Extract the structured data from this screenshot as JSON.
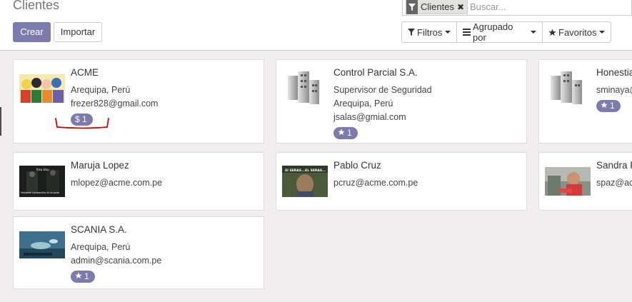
{
  "page": {
    "title": "Clientes"
  },
  "buttons": {
    "create": "Crear",
    "import": "Importar"
  },
  "search": {
    "facet_value": "Clientes",
    "facet_icon": "filter-icon",
    "placeholder": "Buscar..."
  },
  "filters": {
    "filtros": "Filtros",
    "agrupado": "Agrupado por",
    "favoritos": "Favoritos"
  },
  "colors": {
    "accent": "#7c7bad",
    "annotation": "#cc0000"
  },
  "cards": [
    {
      "name": "ACME",
      "lines": [
        "Arequipa, Perú",
        "frezer828@gmail.com"
      ],
      "badge_icon": "dollar-icon",
      "badge": "$ 1",
      "image": "comic-image"
    },
    {
      "name": "Control Parcial S.A.",
      "lines": [
        "Supervisor de Seguridad",
        "Arequipa, Perú",
        "jsalas@gmial.com"
      ],
      "badge_icon": "star-icon",
      "badge": "1",
      "image": "buildings-icon"
    },
    {
      "name": "Honestia",
      "lines": [
        "sminaya@"
      ],
      "badge_icon": "star-icon",
      "badge": "1",
      "image": "buildings-icon"
    },
    {
      "name": "Maruja Lopez",
      "lines": [
        "mlopez@acme.com.pe"
      ],
      "image": "dark-meme-image",
      "image_text": [
        "Kisu kisu",
        "Halovele cucarachito si no puse"
      ]
    },
    {
      "name": "Pablo Cruz",
      "lines": [
        "pcruz@acme.com.pe"
      ],
      "image": "meme-image",
      "image_text": [
        "SI SERAS...EL SERAS..."
      ]
    },
    {
      "name": "Sandra F",
      "lines": [
        "spaz@ac"
      ],
      "image": "photo-image"
    },
    {
      "name": "SCANIA S.A.",
      "lines": [
        "Arequipa, Perú",
        "admin@scania.com.pe"
      ],
      "badge_icon": "star-icon",
      "badge": "1",
      "image": "underwater-image"
    }
  ]
}
